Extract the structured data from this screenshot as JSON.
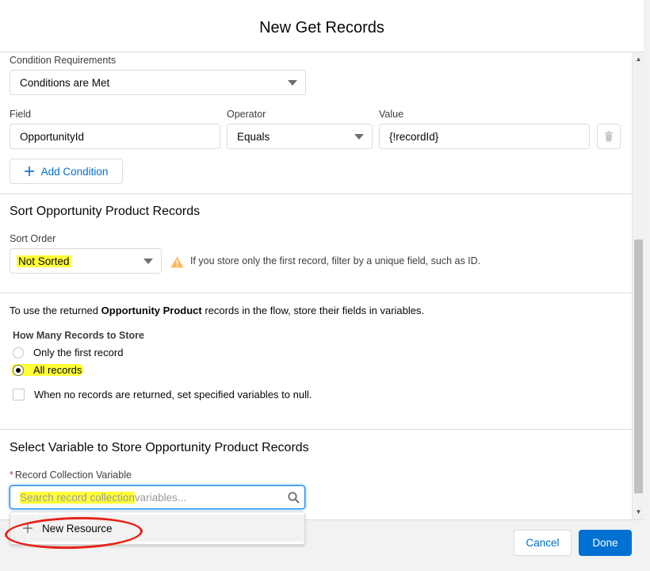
{
  "modal": {
    "title": "New Get Records"
  },
  "conditions": {
    "requirements_label": "Condition Requirements",
    "requirements_value": "Conditions are Met",
    "field_label": "Field",
    "operator_label": "Operator",
    "value_label": "Value",
    "field_value": "OpportunityId",
    "operator_value": "Equals",
    "value_value": "{!recordId}",
    "add_condition_label": "Add Condition"
  },
  "sort": {
    "section_title": "Sort Opportunity Product Records",
    "order_label": "Sort Order",
    "order_value": "Not Sorted",
    "warning_text": "If you store only the first record, filter by a unique field, such as ID."
  },
  "store": {
    "info_prefix": "To use the returned ",
    "info_object": "Opportunity Product",
    "info_suffix": " records in the flow, store their fields in variables.",
    "how_many_label": "How Many Records to Store",
    "option_first": "Only the first record",
    "option_all": "All records",
    "selected_option": "All records",
    "null_checkbox_label": "When no records are returned, set specified variables to null."
  },
  "variable": {
    "section_title": "Select Variable to Store Opportunity Product Records",
    "required_mark": "*",
    "collection_label": "Record Collection Variable",
    "search_placeholder_highlighted": "Search record collection",
    "search_placeholder_rest": " variables...",
    "new_resource_label": "New Resource"
  },
  "footer": {
    "cancel_label": "Cancel",
    "done_label": "Done"
  },
  "colors": {
    "brand": "#0070d2",
    "highlight": "#ffff38",
    "annotation": "#e5231b",
    "warning": "#ffb75d"
  }
}
